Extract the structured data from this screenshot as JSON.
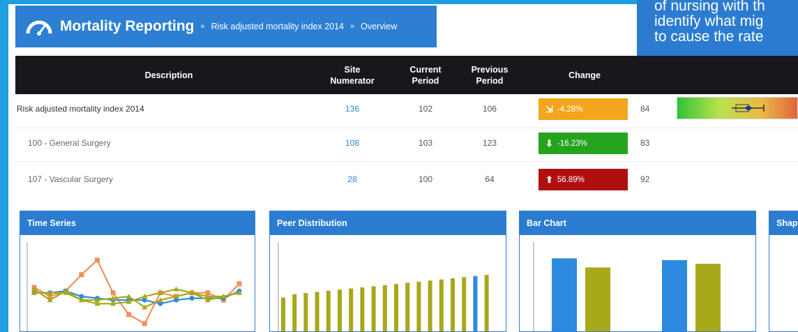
{
  "header": {
    "app_title": "Mortality Reporting",
    "separator": "»",
    "breadcrumbs": [
      "Risk adjusted mortality index 2014",
      "Overview"
    ]
  },
  "overlay": {
    "lines": [
      "of nursing with th",
      "identify what mig",
      "to cause the rate"
    ]
  },
  "table": {
    "columns": {
      "description": "Description",
      "site_numerator": "Site\nNumerator",
      "current_period": "Current\nPeriod",
      "previous_period": "Previous\nPeriod",
      "change": "Change"
    },
    "rows": [
      {
        "description": "Risk adjusted mortality index 2014",
        "site_numerator": "136",
        "current": "102",
        "previous": "106",
        "change": "-4.28%",
        "change_status": "neutral",
        "extra": "84"
      },
      {
        "description": "100 - General Surgery",
        "site_numerator": "108",
        "current": "103",
        "previous": "123",
        "change": "-16.23%",
        "change_status": "good",
        "extra": "83"
      },
      {
        "description": "107 - Vascular Surgery",
        "site_numerator": "28",
        "current": "100",
        "previous": "64",
        "change": "56.89%",
        "change_status": "bad",
        "extra": "92"
      }
    ]
  },
  "colors": {
    "brand_blue": "#2b7cd1",
    "header_dark": "#16181c",
    "neutral": "#f3a51d",
    "good": "#26a31e",
    "bad": "#b00f10",
    "olive": "#a8a81a",
    "orange": "#f0905a",
    "series_blue": "#2d8ae0"
  },
  "panels": [
    {
      "title": "Time Series"
    },
    {
      "title": "Peer Distribution"
    },
    {
      "title": "Bar Chart"
    },
    {
      "title": "Shape"
    }
  ],
  "chart_data": [
    {
      "type": "line",
      "x": [
        1,
        2,
        3,
        4,
        5,
        6,
        7,
        8,
        9,
        10,
        11,
        12,
        13,
        14
      ],
      "series": [
        {
          "values": [
            55,
            50,
            53,
            62,
            70,
            52,
            40,
            35,
            52,
            50,
            52,
            52,
            48,
            57
          ]
        },
        {
          "values": [
            52,
            52,
            53,
            50,
            49,
            48,
            48,
            48,
            46,
            48,
            49,
            49,
            49,
            53
          ]
        },
        {
          "values": [
            54,
            48,
            53,
            48,
            46,
            46,
            47,
            50,
            52,
            54,
            52,
            50,
            50,
            52
          ]
        },
        {
          "values": [
            52,
            52,
            52,
            48,
            48,
            49,
            50,
            44,
            48,
            50,
            52,
            48,
            50,
            52
          ]
        }
      ],
      "ylim": [
        30,
        80
      ]
    },
    {
      "type": "bar",
      "values": [
        0.31,
        0.34,
        0.35,
        0.36,
        0.37,
        0.38,
        0.39,
        0.4,
        0.41,
        0.42,
        0.43,
        0.44,
        0.45,
        0.46,
        0.47,
        0.48,
        0.49,
        0.5,
        0.51
      ],
      "highlight": [
        false,
        false,
        false,
        false,
        false,
        false,
        false,
        false,
        false,
        false,
        false,
        false,
        false,
        false,
        false,
        false,
        false,
        true,
        false
      ],
      "ylim": [
        0,
        0.8
      ]
    },
    {
      "type": "bar",
      "groups": [
        [
          0.82,
          0.72
        ],
        [
          0.8,
          0.76
        ]
      ],
      "ylim": [
        0,
        1
      ]
    }
  ]
}
